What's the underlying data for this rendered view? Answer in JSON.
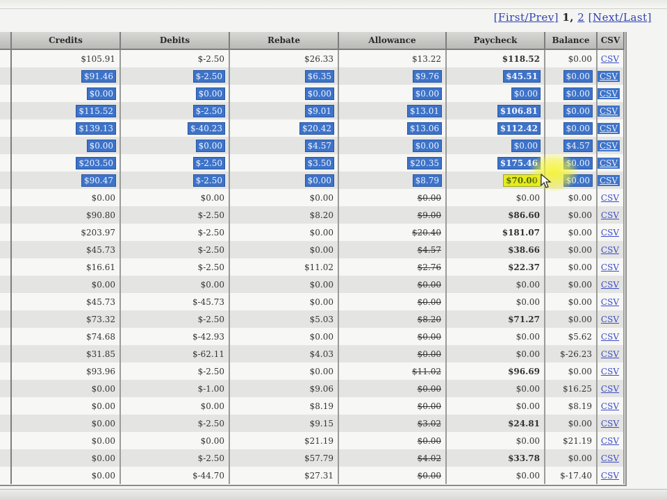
{
  "pager": {
    "first_prev": "[First/Prev]",
    "page1": "1,",
    "page2": "2",
    "next_last": "[Next/Last]"
  },
  "columns": [
    "Credits",
    "Debits",
    "Rebate",
    "Allowance",
    "Paycheck",
    "Balance",
    "CSV"
  ],
  "rows": [
    {
      "credits": "$105.91",
      "debits": "$-2.50",
      "rebate": "$26.33",
      "allowance": "$13.22",
      "paycheck": "$118.52",
      "balance": "$0.00",
      "csv": "CSV",
      "allow_struck": false,
      "pay_green": true
    },
    {
      "credits": "$91.46",
      "debits": "$-2.50",
      "rebate": "$6.35",
      "allowance": "$9.76",
      "paycheck": "$45.51",
      "balance": "$0.00",
      "csv": "CSV",
      "allow_struck": false,
      "pay_green": true,
      "selected": true
    },
    {
      "credits": "$0.00",
      "debits": "$0.00",
      "rebate": "$0.00",
      "allowance": "$0.00",
      "paycheck": "$0.00",
      "balance": "$0.00",
      "csv": "CSV",
      "allow_struck": false,
      "pay_green": false,
      "selected": true
    },
    {
      "credits": "$115.52",
      "debits": "$-2.50",
      "rebate": "$9.01",
      "allowance": "$13.01",
      "paycheck": "$106.81",
      "balance": "$0.00",
      "csv": "CSV",
      "allow_struck": false,
      "pay_green": true,
      "selected": true
    },
    {
      "credits": "$139.13",
      "debits": "$-40.23",
      "rebate": "$20.42",
      "allowance": "$13.06",
      "paycheck": "$112.42",
      "balance": "$0.00",
      "csv": "CSV",
      "allow_struck": false,
      "pay_green": true,
      "selected": true
    },
    {
      "credits": "$0.00",
      "debits": "$0.00",
      "rebate": "$4.57",
      "allowance": "$0.00",
      "paycheck": "$0.00",
      "balance": "$4.57",
      "csv": "CSV",
      "allow_struck": false,
      "pay_green": false,
      "selected": true
    },
    {
      "credits": "$203.50",
      "debits": "$-2.50",
      "rebate": "$3.50",
      "allowance": "$20.35",
      "paycheck": "$175.46",
      "balance": "$0.00",
      "csv": "CSV",
      "allow_struck": false,
      "pay_green": true,
      "selected": true
    },
    {
      "credits": "$90.47",
      "debits": "$-2.50",
      "rebate": "$0.00",
      "allowance": "$8.79",
      "paycheck": "$70.00",
      "balance": "$0.00",
      "csv": "CSV",
      "allow_struck": false,
      "pay_green": true,
      "selected": true,
      "pay_highlight": true
    },
    {
      "credits": "$0.00",
      "debits": "$0.00",
      "rebate": "$0.00",
      "allowance": "$0.00",
      "paycheck": "$0.00",
      "balance": "$0.00",
      "csv": "CSV",
      "allow_struck": true,
      "pay_green": false
    },
    {
      "credits": "$90.80",
      "debits": "$-2.50",
      "rebate": "$8.20",
      "allowance": "$9.00",
      "paycheck": "$86.60",
      "balance": "$0.00",
      "csv": "CSV",
      "allow_struck": true,
      "pay_green": true
    },
    {
      "credits": "$203.97",
      "debits": "$-2.50",
      "rebate": "$0.00",
      "allowance": "$20.40",
      "paycheck": "$181.07",
      "balance": "$0.00",
      "csv": "CSV",
      "allow_struck": true,
      "pay_green": true
    },
    {
      "credits": "$45.73",
      "debits": "$-2.50",
      "rebate": "$0.00",
      "allowance": "$4.57",
      "paycheck": "$38.66",
      "balance": "$0.00",
      "csv": "CSV",
      "allow_struck": true,
      "pay_green": true
    },
    {
      "credits": "$16.61",
      "debits": "$-2.50",
      "rebate": "$11.02",
      "allowance": "$2.76",
      "paycheck": "$22.37",
      "balance": "$0.00",
      "csv": "CSV",
      "allow_struck": true,
      "pay_green": true
    },
    {
      "credits": "$0.00",
      "debits": "$0.00",
      "rebate": "$0.00",
      "allowance": "$0.00",
      "paycheck": "$0.00",
      "balance": "$0.00",
      "csv": "CSV",
      "allow_struck": true,
      "pay_green": false
    },
    {
      "credits": "$45.73",
      "debits": "$-45.73",
      "rebate": "$0.00",
      "allowance": "$0.00",
      "paycheck": "$0.00",
      "balance": "$0.00",
      "csv": "CSV",
      "allow_struck": true,
      "pay_green": false
    },
    {
      "credits": "$73.32",
      "debits": "$-2.50",
      "rebate": "$5.03",
      "allowance": "$8.20",
      "paycheck": "$71.27",
      "balance": "$0.00",
      "csv": "CSV",
      "allow_struck": true,
      "pay_green": true
    },
    {
      "credits": "$74.68",
      "debits": "$-42.93",
      "rebate": "$0.00",
      "allowance": "$0.00",
      "paycheck": "$0.00",
      "balance": "$5.62",
      "csv": "CSV",
      "allow_struck": true,
      "pay_green": false
    },
    {
      "credits": "$31.85",
      "debits": "$-62.11",
      "rebate": "$4.03",
      "allowance": "$0.00",
      "paycheck": "$0.00",
      "balance": "$-26.23",
      "csv": "CSV",
      "allow_struck": true,
      "pay_green": false
    },
    {
      "credits": "$93.96",
      "debits": "$-2.50",
      "rebate": "$0.00",
      "allowance": "$11.02",
      "paycheck": "$96.69",
      "balance": "$0.00",
      "csv": "CSV",
      "allow_struck": true,
      "pay_green": true
    },
    {
      "credits": "$0.00",
      "debits": "$-1.00",
      "rebate": "$9.06",
      "allowance": "$0.00",
      "paycheck": "$0.00",
      "balance": "$16.25",
      "csv": "CSV",
      "allow_struck": true,
      "pay_green": false
    },
    {
      "credits": "$0.00",
      "debits": "$0.00",
      "rebate": "$8.19",
      "allowance": "$0.00",
      "paycheck": "$0.00",
      "balance": "$8.19",
      "csv": "CSV",
      "allow_struck": true,
      "pay_green": false
    },
    {
      "credits": "$0.00",
      "debits": "$-2.50",
      "rebate": "$9.15",
      "allowance": "$3.02",
      "paycheck": "$24.81",
      "balance": "$0.00",
      "csv": "CSV",
      "allow_struck": true,
      "pay_green": true
    },
    {
      "credits": "$0.00",
      "debits": "$0.00",
      "rebate": "$21.19",
      "allowance": "$0.00",
      "paycheck": "$0.00",
      "balance": "$21.19",
      "csv": "CSV",
      "allow_struck": true,
      "pay_green": false
    },
    {
      "credits": "$0.00",
      "debits": "$-2.50",
      "rebate": "$57.79",
      "allowance": "$4.02",
      "paycheck": "$33.78",
      "balance": "$0.00",
      "csv": "CSV",
      "allow_struck": true,
      "pay_green": true
    },
    {
      "credits": "$0.00",
      "debits": "$-44.70",
      "rebate": "$27.31",
      "allowance": "$0.00",
      "paycheck": "$0.00",
      "balance": "$-17.40",
      "csv": "CSV",
      "allow_struck": true,
      "pay_green": false
    }
  ],
  "colors": {
    "negative": "#c8372f",
    "allowance": "#2b3bb3",
    "paycheck": "#218a2a",
    "selection": "#3d73c8",
    "highlight": "#e8ea1c"
  },
  "icons": {
    "cursor": "mouse-pointer-icon"
  }
}
